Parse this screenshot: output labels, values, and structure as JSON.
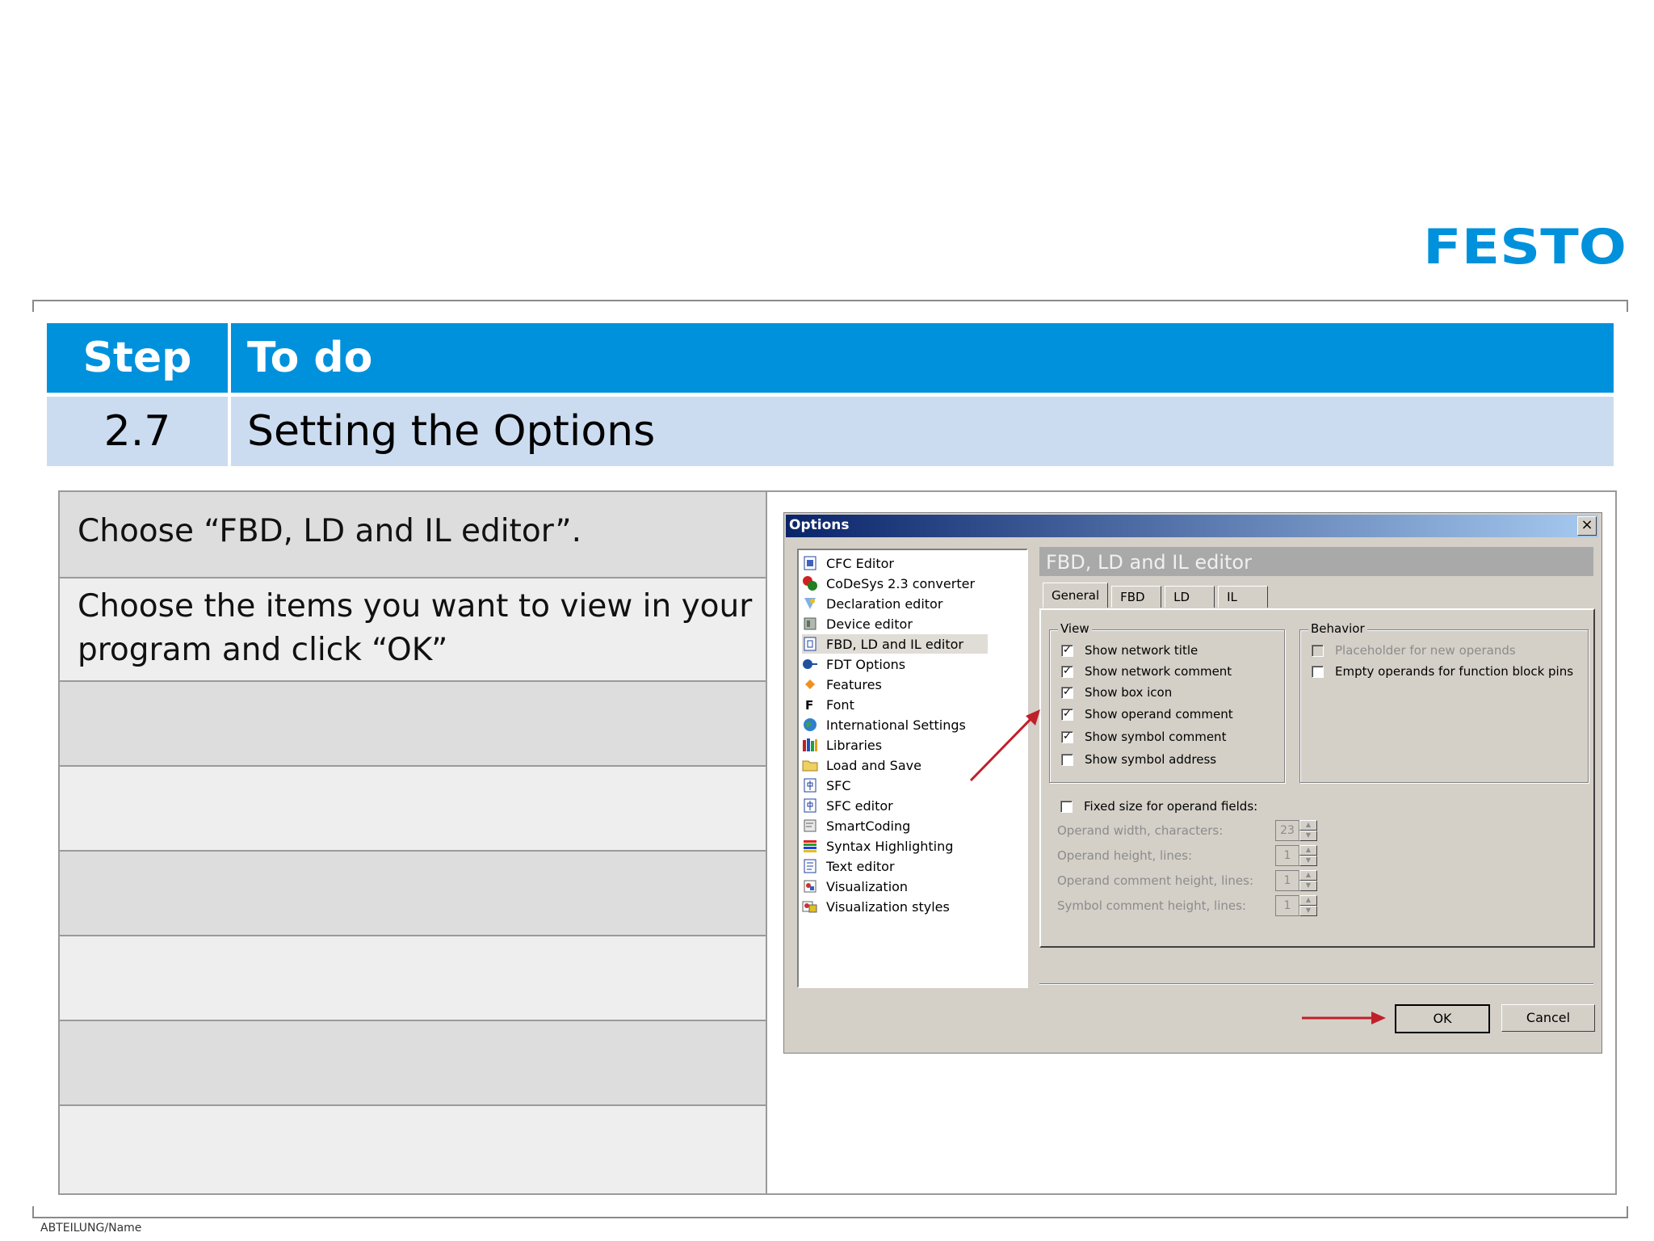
{
  "brand": {
    "logo_text": "FESTO",
    "color": "#0091dc"
  },
  "header": {
    "col_step": "Step",
    "col_todo": "To do",
    "step_number": "2.7",
    "step_title": "Setting the Options"
  },
  "instructions": [
    {
      "text": "Choose “FBD, LD and IL editor”."
    },
    {
      "text": "Choose the items you want to view in your program and click “OK”"
    }
  ],
  "dialog": {
    "title": "Options",
    "close_glyph": "×",
    "tree": [
      {
        "label": "CFC Editor",
        "icon": "cfc-icon"
      },
      {
        "label": "CoDeSys 2.3 converter",
        "icon": "converter-icon"
      },
      {
        "label": "Declaration editor",
        "icon": "declaration-icon"
      },
      {
        "label": "Device editor",
        "icon": "device-icon"
      },
      {
        "label": "FBD, LD and IL editor",
        "icon": "fbd-icon",
        "selected": true
      },
      {
        "label": "FDT Options",
        "icon": "fdt-icon"
      },
      {
        "label": "Features",
        "icon": "features-icon"
      },
      {
        "label": "Font",
        "icon": "font-icon"
      },
      {
        "label": "International Settings",
        "icon": "globe-icon"
      },
      {
        "label": "Libraries",
        "icon": "libraries-icon"
      },
      {
        "label": "Load and Save",
        "icon": "folder-icon"
      },
      {
        "label": "SFC",
        "icon": "sfc-icon"
      },
      {
        "label": "SFC editor",
        "icon": "sfc-editor-icon"
      },
      {
        "label": "SmartCoding",
        "icon": "smartcoding-icon"
      },
      {
        "label": "Syntax Highlighting",
        "icon": "syntax-icon"
      },
      {
        "label": "Text editor",
        "icon": "text-editor-icon"
      },
      {
        "label": "Visualization",
        "icon": "visualization-icon"
      },
      {
        "label": "Visualization styles",
        "icon": "visualization-styles-icon"
      }
    ],
    "panel_title": "FBD, LD and IL editor",
    "tabs": [
      "General",
      "FBD",
      "LD",
      "IL"
    ],
    "view": {
      "label": "View",
      "options": [
        {
          "label": "Show network title",
          "checked": true
        },
        {
          "label": "Show network comment",
          "checked": true
        },
        {
          "label": "Show box icon",
          "checked": true
        },
        {
          "label": "Show operand comment",
          "checked": true
        },
        {
          "label": "Show symbol comment",
          "checked": true
        },
        {
          "label": "Show symbol address",
          "checked": false
        }
      ]
    },
    "behavior": {
      "label": "Behavior",
      "options": [
        {
          "label": "Placeholder for new operands",
          "checked": false,
          "disabled": true
        },
        {
          "label": "Empty operands for function block pins",
          "checked": false,
          "disabled": false
        }
      ]
    },
    "fixed_size": {
      "label": "Fixed size for operand fields:",
      "checked": false
    },
    "fields": [
      {
        "label": "Operand width, characters:",
        "value": "23"
      },
      {
        "label": "Operand height, lines:",
        "value": "1"
      },
      {
        "label": "Operand comment height, lines:",
        "value": "1"
      },
      {
        "label": "Symbol comment height, lines:",
        "value": "1"
      }
    ],
    "ok_label": "OK",
    "cancel_label": "Cancel",
    "check_glyph": "✓",
    "spin_up": "▲",
    "spin_down": "▼"
  },
  "footer": {
    "text": "ABTEILUNG/Name"
  },
  "colors": {
    "header_blue": "#0091dc",
    "header_light": "#ccdcf0",
    "annotation_arrow": "#c0202a"
  }
}
